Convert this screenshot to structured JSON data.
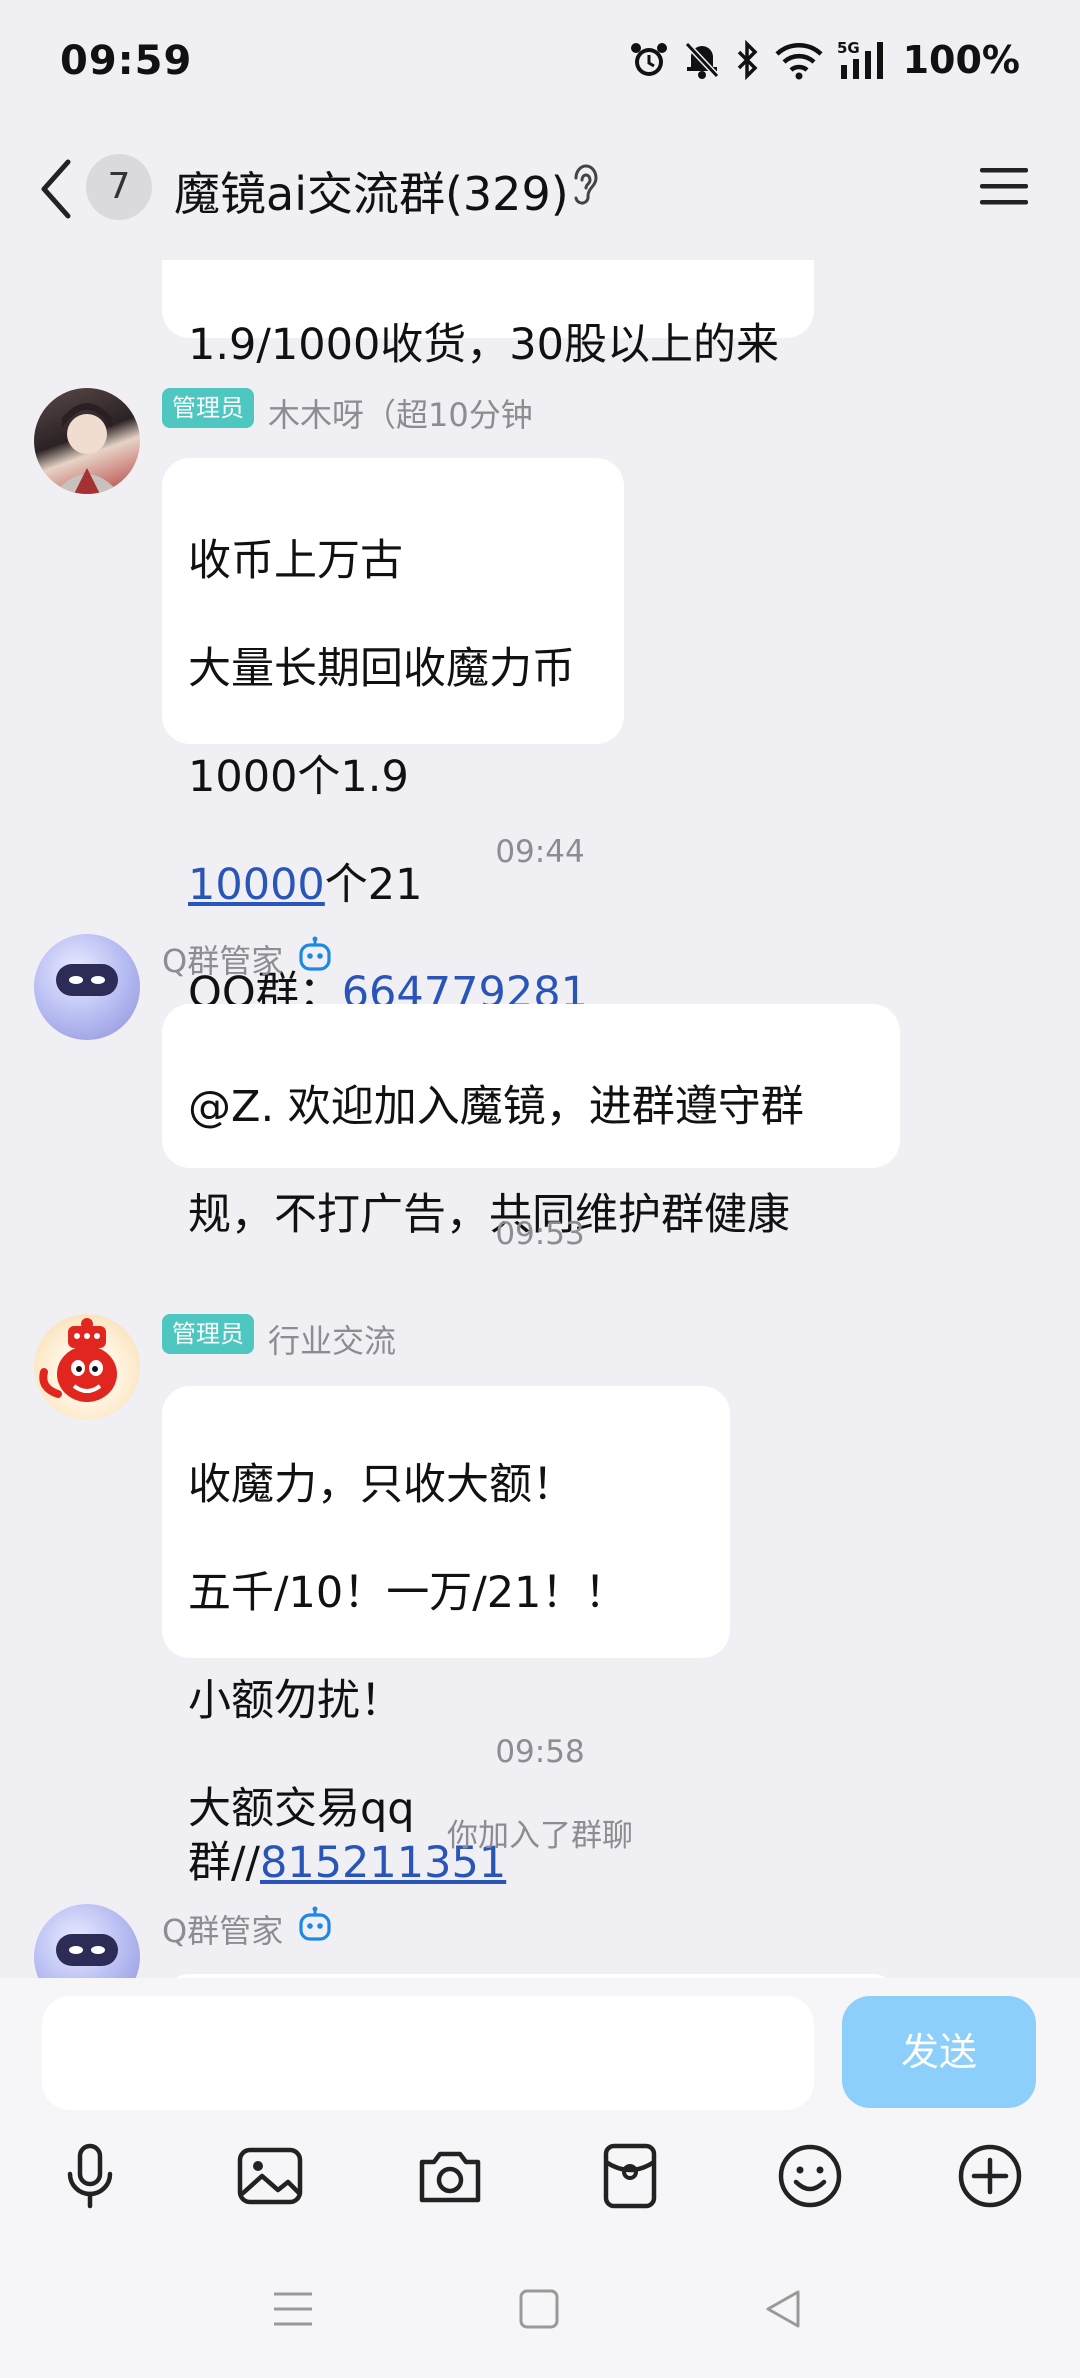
{
  "status_bar": {
    "time": "09:59",
    "battery": "100%",
    "network": "5G",
    "icons": [
      "alarm-icon",
      "mute-icon",
      "bluetooth-icon",
      "wifi-icon",
      "signal-icon"
    ]
  },
  "header": {
    "unread_count": "7",
    "title": "魔镜ai交流群(329)",
    "icons": [
      "back-icon",
      "ear-icon",
      "menu-icon"
    ]
  },
  "messages": [
    {
      "type": "text",
      "lines": [
        "1.9/1000收货，30股以上的来"
      ]
    },
    {
      "type": "text",
      "role_badge": "管理员",
      "sender": "木木呀（超10分钟",
      "lines": [
        "收币上万古",
        "大量长期回收魔力币",
        "1000个1.9"
      ],
      "line4_link": "10000",
      "line4_rest": "个21",
      "line5_prefix": "QQ群：",
      "line5_link": "664779281"
    },
    {
      "type": "time",
      "text": "09:44"
    },
    {
      "type": "text",
      "sender": "Q群管家",
      "lines": [
        "@Z. 欢迎加入魔镜，进群遵守群",
        "规，不打广告，共同维护群健康"
      ]
    },
    {
      "type": "time",
      "text": "09:53"
    },
    {
      "type": "text",
      "role_badge": "管理员",
      "sender": "行业交流",
      "lines": [
        "收魔力，只收大额！",
        "五千/10！一万/21！！",
        "小额勿扰！"
      ],
      "line4_prefix": "大额交易qq群//",
      "line4_link": "815211351"
    },
    {
      "type": "time",
      "text": "09:58"
    },
    {
      "type": "system",
      "text": "你加入了群聊"
    },
    {
      "type": "text",
      "sender": "Q群管家"
    }
  ],
  "input_bar": {
    "placeholder": "",
    "send_label": "发送",
    "tools": [
      "microphone-icon",
      "image-icon",
      "camera-icon",
      "red-packet-icon",
      "emoji-icon",
      "plus-icon"
    ]
  },
  "nav_bar": {
    "icons": [
      "recent-apps-icon",
      "home-icon",
      "back-nav-icon"
    ]
  },
  "colors": {
    "background": "#efeff4",
    "bubble": "#ffffff",
    "link": "#2a55b8",
    "admin_badge": "#4ec7c1",
    "send_button": "#8ccffa",
    "bot_icon": "#1e88e5"
  }
}
